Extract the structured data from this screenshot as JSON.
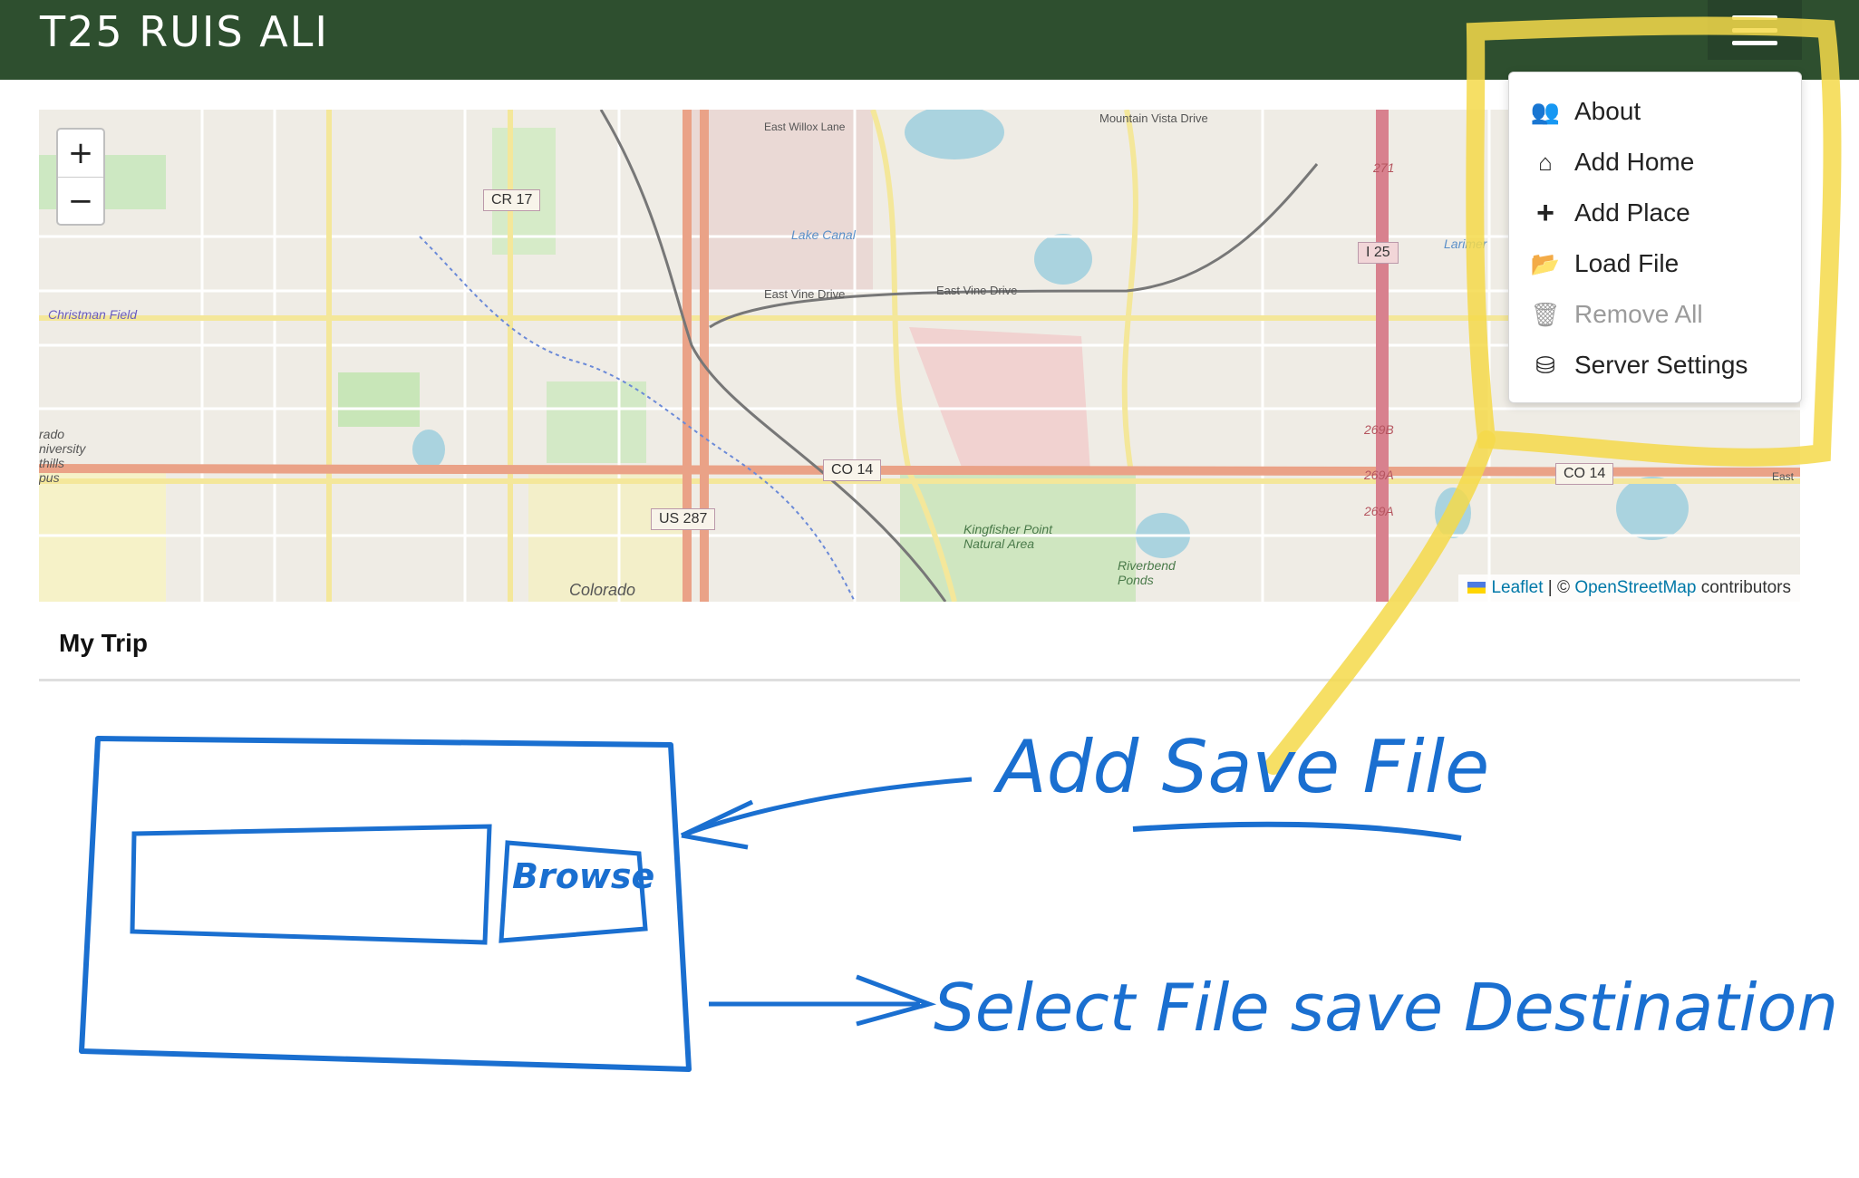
{
  "header": {
    "title": "T25 RUIS ALI",
    "menu_toggle_icon": "hamburger-icon",
    "background": "#2e4f2f"
  },
  "map": {
    "zoom_in": "+",
    "zoom_out": "−",
    "labels": {
      "christman_field": "Christman Field",
      "cr17": "CR 17",
      "east_vine_drive_1": "East Vine Drive",
      "east_vine_drive_2": "East Vine Drive",
      "mountain_vista": "Mountain Vista Drive",
      "east_willox": "East Willox Lane",
      "lake_canal": "Lake Canal",
      "i25": "I 25",
      "i271": "271",
      "co14_left": "CO 14",
      "co14_right": "CO 14",
      "us287": "US 287",
      "exit269b": "269B",
      "exit269a_1": "269A",
      "exit269a_2": "269A",
      "kingfisher": "Kingfisher Point Natural Area",
      "riverbend": "Riverbend Ponds",
      "colorado": "Colorado",
      "larimer": "Larimer",
      "university": "rado\nniversity\nthills\npus",
      "east": "East"
    },
    "attribution": {
      "leaflet": "Leaflet",
      "separator": " | © ",
      "osm": "OpenStreetMap",
      "contributors": " contributors"
    }
  },
  "menu": {
    "items": [
      {
        "label": "About",
        "icon": "users-icon",
        "glyph": "👥",
        "disabled": false
      },
      {
        "label": "Add Home",
        "icon": "home-icon",
        "glyph": "⌂",
        "disabled": false
      },
      {
        "label": "Add Place",
        "icon": "plus-icon",
        "glyph": "+",
        "disabled": false
      },
      {
        "label": "Load File",
        "icon": "folder-open-icon",
        "glyph": "📂",
        "disabled": false
      },
      {
        "label": "Remove All",
        "icon": "trash-icon",
        "glyph": "🗑",
        "disabled": true
      },
      {
        "label": "Server Settings",
        "icon": "server-icon",
        "glyph": "⛁",
        "disabled": false
      }
    ]
  },
  "trip": {
    "title": "My Trip"
  },
  "annotations": {
    "browse_button": "Browse",
    "add_save_file": "Add Save File",
    "select_destination": "Select File save Destination",
    "highlight_color": "#f5d94a",
    "ink_color": "#1a6fd0"
  }
}
